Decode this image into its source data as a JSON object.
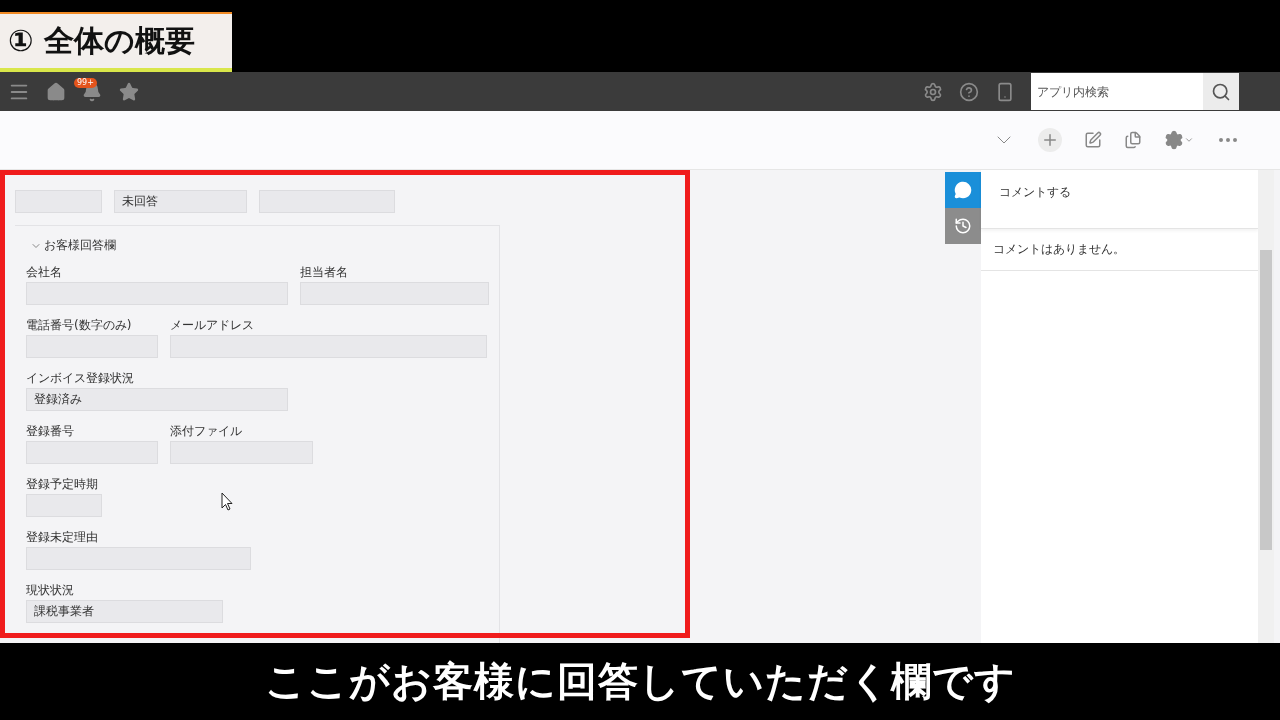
{
  "video_title": "① 全体の概要",
  "header": {
    "notification_badge": "99+",
    "search": {
      "placeholder": "アプリ内検索"
    }
  },
  "top_row": {
    "status_value": "未回答"
  },
  "section": {
    "title": "お客様回答欄",
    "expanded": true,
    "rows": [
      [
        {
          "label": "会社名"
        },
        {
          "label": "担当者名"
        }
      ],
      [
        {
          "label": "電話番号(数字のみ)"
        },
        {
          "label": "メールアドレス"
        }
      ],
      [
        {
          "label": "インボイス登録状況",
          "value": "登録済み"
        }
      ],
      [
        {
          "label": "登録番号"
        },
        {
          "label": "添付ファイル"
        }
      ],
      [
        {
          "label": "登録予定時期"
        }
      ],
      [
        {
          "label": "登録未定理由"
        }
      ],
      [
        {
          "label": "現状状況",
          "value": "課税事業者"
        }
      ]
    ]
  },
  "comments": {
    "placeholder": "コメントする",
    "empty_message": "コメントはありません。"
  },
  "caption": "ここがお客様に回答していただく欄です"
}
